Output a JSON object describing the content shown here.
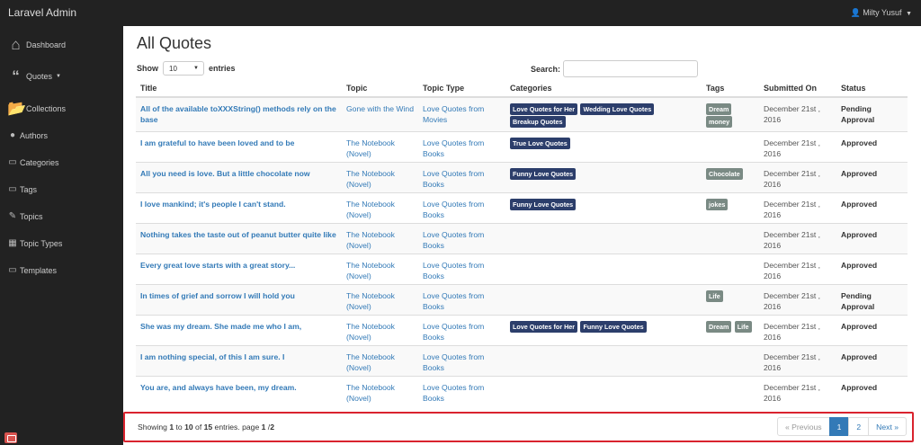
{
  "app": {
    "brand": "Laravel Admin",
    "user_name": "Milty Yusuf",
    "user_icon": "user-icon"
  },
  "sidebar": {
    "items": [
      {
        "label": "Dashboard",
        "icon": "home-icon"
      },
      {
        "label": "Quotes",
        "icon": "quote-icon"
      },
      {
        "label": "Collections",
        "icon": "folder-open-icon"
      },
      {
        "label": "Authors",
        "icon": "users-icon"
      },
      {
        "label": "Categories",
        "icon": "desktop-icon"
      },
      {
        "label": "Tags",
        "icon": "desktop-icon"
      },
      {
        "label": "Topics",
        "icon": "edit-icon"
      },
      {
        "label": "Topic Types",
        "icon": "table-icon"
      },
      {
        "label": "Templates",
        "icon": "desktop-icon"
      }
    ]
  },
  "page": {
    "title": "All Quotes"
  },
  "length": {
    "show_label": "Show",
    "value": "10",
    "entries_label": "entries"
  },
  "search": {
    "label": "Search:",
    "value": ""
  },
  "table": {
    "headers": {
      "title": "Title",
      "topic": "Topic",
      "topic_type": "Topic Type",
      "categories": "Categories",
      "tags": "Tags",
      "submitted": "Submitted On",
      "status": "Status"
    },
    "rows": [
      {
        "title": "All of the available toXXXString() methods rely on the base",
        "topic": "Gone with the Wind",
        "topic_type": "Love Quotes from Movies",
        "categories": [
          "Love Quotes for Her",
          "Wedding Love Quotes",
          "Breakup Quotes"
        ],
        "tags": [
          "Dream",
          "money"
        ],
        "submitted": "December 21st , 2016",
        "status": "Pending Approval"
      },
      {
        "title": "I am grateful to have been loved and to be",
        "topic": "The Notebook (Novel)",
        "topic_type": "Love Quotes from Books",
        "categories": [
          "True Love Quotes"
        ],
        "tags": [],
        "submitted": "December 21st , 2016",
        "status": "Approved"
      },
      {
        "title": "All you need is love. But a little chocolate now",
        "topic": "The Notebook (Novel)",
        "topic_type": "Love Quotes from Books",
        "categories": [
          "Funny Love Quotes"
        ],
        "tags": [
          "Chocolate"
        ],
        "submitted": "December 21st , 2016",
        "status": "Approved"
      },
      {
        "title": "I love mankind; it's people I can't stand.",
        "topic": "The Notebook (Novel)",
        "topic_type": "Love Quotes from Books",
        "categories": [
          "Funny Love Quotes"
        ],
        "tags": [
          "jokes"
        ],
        "submitted": "December 21st , 2016",
        "status": "Approved"
      },
      {
        "title": "Nothing takes the taste out of peanut butter quite like",
        "topic": "The Notebook (Novel)",
        "topic_type": "Love Quotes from Books",
        "categories": [],
        "tags": [],
        "submitted": "December 21st , 2016",
        "status": "Approved"
      },
      {
        "title": "Every great love starts with a great story...",
        "topic": "The Notebook (Novel)",
        "topic_type": "Love Quotes from Books",
        "categories": [],
        "tags": [],
        "submitted": "December 21st , 2016",
        "status": "Approved"
      },
      {
        "title": "In times of grief and sorrow I will hold you",
        "topic": "The Notebook (Novel)",
        "topic_type": "Love Quotes from Books",
        "categories": [],
        "tags": [
          "Life"
        ],
        "submitted": "December 21st , 2016",
        "status": "Pending Approval"
      },
      {
        "title": "She was my dream. She made me who I am,",
        "topic": "The Notebook (Novel)",
        "topic_type": "Love Quotes from Books",
        "categories": [
          "Love Quotes for Her",
          "Funny Love Quotes"
        ],
        "tags": [
          "Dream",
          "Life"
        ],
        "submitted": "December 21st , 2016",
        "status": "Approved"
      },
      {
        "title": "I am nothing special, of this I am sure. I",
        "topic": "The Notebook (Novel)",
        "topic_type": "Love Quotes from Books",
        "categories": [],
        "tags": [],
        "submitted": "December 21st , 2016",
        "status": "Approved"
      },
      {
        "title": "You are, and always have been, my dream.",
        "topic": "The Notebook (Novel)",
        "topic_type": "Love Quotes from Books",
        "categories": [],
        "tags": [],
        "submitted": "December 21st , 2016",
        "status": "Approved"
      }
    ]
  },
  "footer": {
    "info": {
      "prefix": "Showing ",
      "from": "1",
      "to_word": " to ",
      "to": "10",
      "of_word": " of ",
      "total": "15",
      "entries_page": " entries. page ",
      "page": "1",
      "sep": " /",
      "pages": "2"
    },
    "pagination": {
      "previous": "« Previous",
      "pages": [
        "1",
        "2"
      ],
      "active": "1",
      "next": "Next »"
    }
  },
  "colors": {
    "sidebar_bg": "#222222",
    "category_label": "#2c3e6b",
    "tag_label": "#7a8a84",
    "link": "#337ab7",
    "highlight_border": "#d9232e"
  }
}
